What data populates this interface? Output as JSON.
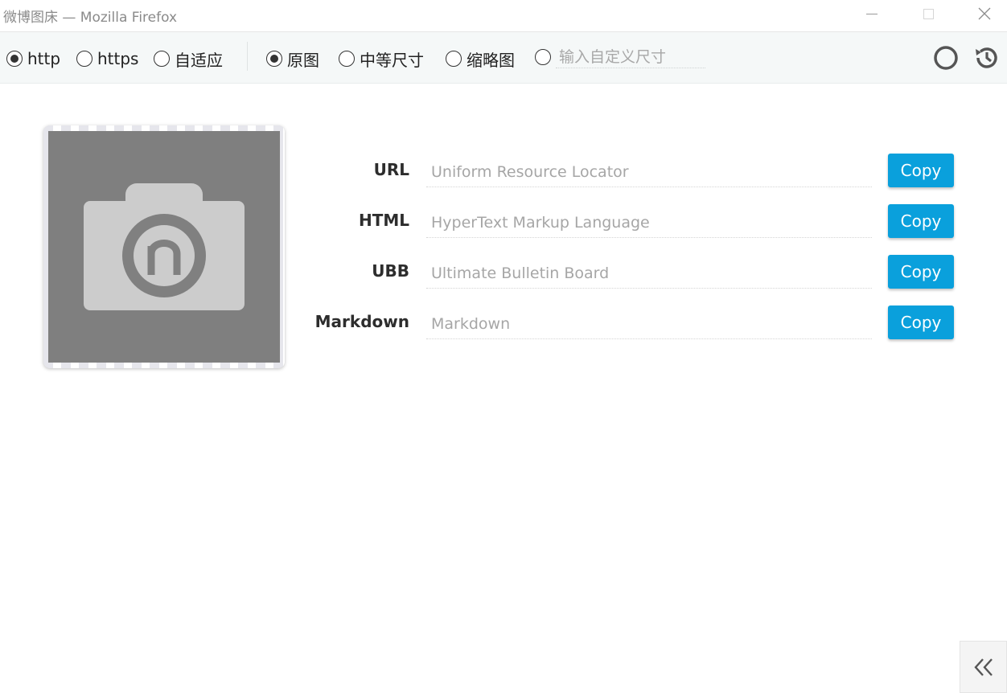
{
  "window": {
    "title": "微博图床 — Mozilla Firefox"
  },
  "toolbar": {
    "protocol_options": [
      {
        "label": "http",
        "checked": true
      },
      {
        "label": "https",
        "checked": false
      },
      {
        "label": "自适应",
        "checked": false
      }
    ],
    "size_options": [
      {
        "label": "原图",
        "checked": true
      },
      {
        "label": "中等尺寸",
        "checked": false
      },
      {
        "label": "缩略图",
        "checked": false
      }
    ],
    "custom_size": {
      "placeholder": "输入自定义尺寸",
      "value": ""
    },
    "icons": [
      "circle-icon",
      "history-icon"
    ]
  },
  "links": [
    {
      "label": "URL",
      "placeholder": "Uniform Resource Locator",
      "button": "Copy"
    },
    {
      "label": "HTML",
      "placeholder": "HyperText Markup Language",
      "button": "Copy"
    },
    {
      "label": "UBB",
      "placeholder": "Ultimate Bulletin Board",
      "button": "Copy"
    },
    {
      "label": "Markdown",
      "placeholder": "Markdown",
      "button": "Copy"
    }
  ],
  "colors": {
    "accent": "#0aa0dc",
    "toolbar_bg": "#f5f8f8",
    "preview_bg": "#7f7f7f"
  }
}
